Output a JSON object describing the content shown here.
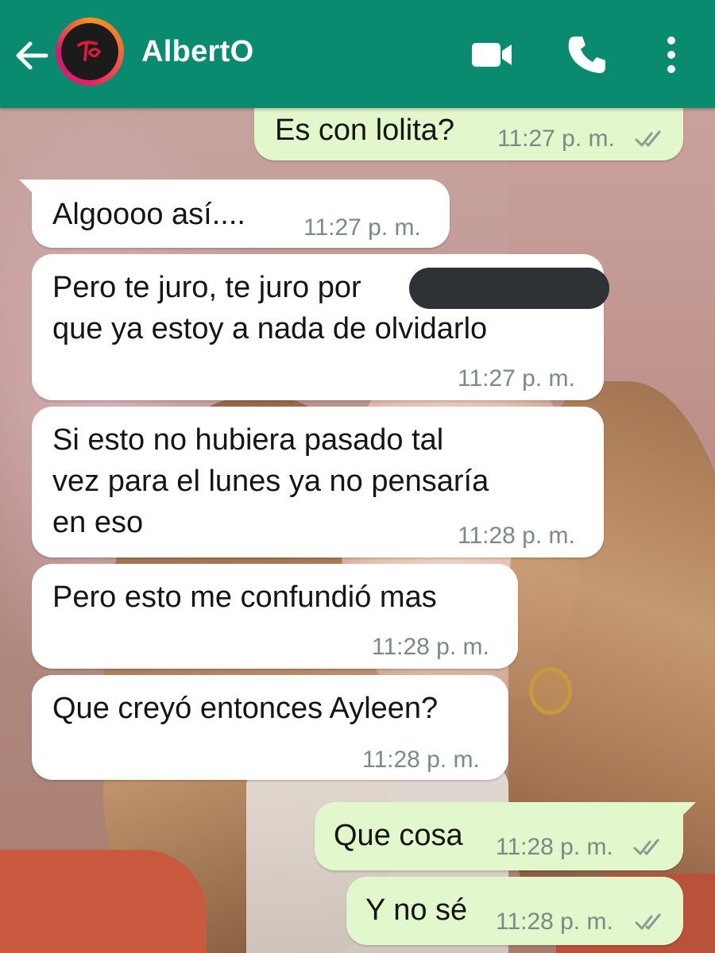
{
  "header": {
    "contact_name": "AlbertO",
    "back_icon": "arrow-left-icon",
    "video_icon": "video-camera-icon",
    "call_icon": "phone-icon",
    "menu_icon": "more-vertical-icon"
  },
  "colors": {
    "header_bg": "#0a8a6e",
    "incoming_bubble": "#ffffff",
    "outgoing_bubble": "#e2f7cb",
    "timestamp": "#7c8a86"
  },
  "messages": [
    {
      "direction": "outgoing",
      "text": "Es con lolita?",
      "time": "11:27 p. m.",
      "status": "read"
    },
    {
      "direction": "incoming",
      "text": "Algoooo así....",
      "time": "11:27 p. m."
    },
    {
      "direction": "incoming",
      "text": "Pero te juro, te juro por\nque ya estoy a nada de olvidarlo",
      "time": "11:27 p. m.",
      "redacted": true
    },
    {
      "direction": "incoming",
      "text": "Si esto no hubiera pasado tal\nvez para el lunes ya no pensaría\nen eso",
      "time": "11:28 p. m."
    },
    {
      "direction": "incoming",
      "text": "Pero esto me confundió mas",
      "time": "11:28 p. m."
    },
    {
      "direction": "incoming",
      "text": "Que creyó entonces Ayleen?",
      "time": "11:28 p. m."
    },
    {
      "direction": "outgoing",
      "text": "Que cosa",
      "time": "11:28 p. m.",
      "status": "read"
    },
    {
      "direction": "outgoing",
      "text": "Y no sé",
      "time": "11:28 p. m.",
      "status": "read"
    }
  ]
}
